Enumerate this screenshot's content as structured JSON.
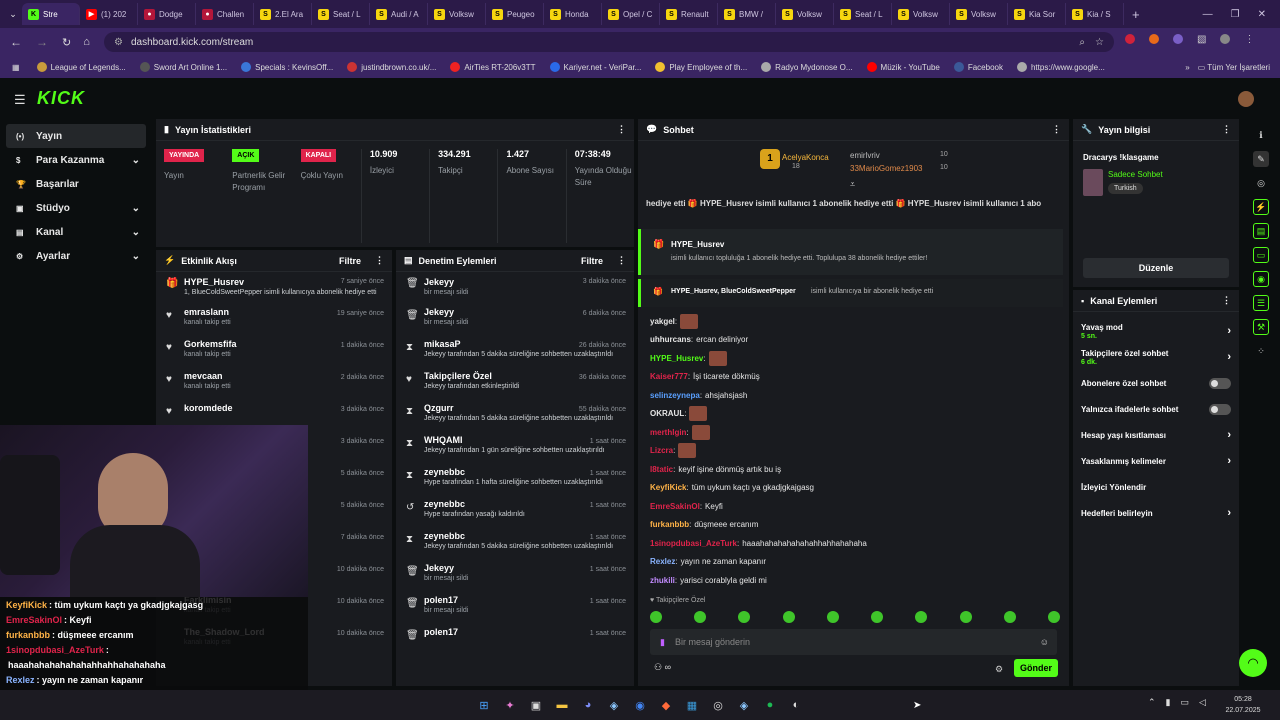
{
  "browser": {
    "tabs": [
      {
        "label": "Stre",
        "icon": "K",
        "color": "#53fc18",
        "active": true
      },
      {
        "label": "(1) 202",
        "icon": "▶",
        "color": "#ff0000"
      },
      {
        "label": "Dodge",
        "icon": "●",
        "color": "#b3163a"
      },
      {
        "label": "Challen",
        "icon": "●",
        "color": "#b3163a"
      },
      {
        "label": "2.El Ara",
        "icon": "S",
        "color": "#f6d60f"
      },
      {
        "label": "Seat / L",
        "icon": "S",
        "color": "#f6d60f"
      },
      {
        "label": "Audi / A",
        "icon": "S",
        "color": "#f6d60f"
      },
      {
        "label": "Volksw",
        "icon": "S",
        "color": "#f6d60f"
      },
      {
        "label": "Peugeo",
        "icon": "S",
        "color": "#f6d60f"
      },
      {
        "label": "Honda",
        "icon": "S",
        "color": "#f6d60f"
      },
      {
        "label": "Opel / C",
        "icon": "S",
        "color": "#f6d60f"
      },
      {
        "label": "Renault",
        "icon": "S",
        "color": "#f6d60f"
      },
      {
        "label": "BMW /",
        "icon": "S",
        "color": "#f6d60f"
      },
      {
        "label": "Volksw",
        "icon": "S",
        "color": "#f6d60f"
      },
      {
        "label": "Seat / L",
        "icon": "S",
        "color": "#f6d60f"
      },
      {
        "label": "Volksw",
        "icon": "S",
        "color": "#f6d60f"
      },
      {
        "label": "Volksw",
        "icon": "S",
        "color": "#f6d60f"
      },
      {
        "label": "Kia Sor",
        "icon": "S",
        "color": "#f6d60f"
      },
      {
        "label": "Kia / S",
        "icon": "S",
        "color": "#f6d60f"
      }
    ],
    "url": "dashboard.kick.com/stream",
    "bookmarks": [
      "League of Legends...",
      "Sword Art Online 1...",
      "Specials : KevinsOff...",
      "justindbrown.co.uk/...",
      "AirTies RT-206v3TT",
      "Kariyer.net - VeriPar...",
      "Play Employee of th...",
      "Radyo Mydonose O...",
      "Müzik - YouTube",
      "Facebook",
      "https://www.google..."
    ],
    "bookmarks_all": "Tüm Yer İşaretleri"
  },
  "sidebar": [
    {
      "label": "Yayın",
      "icon": "(•)",
      "active": true
    },
    {
      "label": "Para Kazanma",
      "icon": "$",
      "chevron": true
    },
    {
      "label": "Başarılar",
      "icon": "🏆"
    },
    {
      "label": "Stüdyo",
      "icon": "▣",
      "chevron": true
    },
    {
      "label": "Kanal",
      "icon": "▤",
      "chevron": true
    },
    {
      "label": "Ayarlar",
      "icon": "⚙",
      "chevron": true
    }
  ],
  "stats": {
    "title": "Yayın İstatistikleri",
    "badges": [
      {
        "badge": "YAYINDA",
        "color": "#e0244b",
        "label": "Yayın"
      },
      {
        "badge": "AÇIK",
        "color": "#53fc18",
        "label": "Partnerlik Gelir Programı"
      },
      {
        "badge": "KAPALI",
        "color": "#e0244b",
        "label": "Çoklu Yayın"
      }
    ],
    "nums": [
      {
        "value": "10.909",
        "label": "İzleyici"
      },
      {
        "value": "334.291",
        "label": "Takipçi"
      },
      {
        "value": "1.427",
        "label": "Abone Sayısı"
      },
      {
        "value": "07:38:49",
        "label": "Yayında Olduğu Süre"
      }
    ]
  },
  "activity": {
    "title": "Etkinlik Akışı",
    "filter": "Filtre",
    "items": [
      {
        "name": "HYPE_Husrev",
        "sub": "1, BlueColdSweetPepper isimli kullanıcıya abonelik hediye etti",
        "time": "7 saniye önce",
        "icon": "🎁"
      },
      {
        "name": "emraslann",
        "sub": "kanalı takip etti",
        "time": "19 saniye önce",
        "icon": "♥"
      },
      {
        "name": "Gorkemsfifa",
        "sub": "kanalı takip etti",
        "time": "1 dakika önce",
        "icon": "♥"
      },
      {
        "name": "mevcaan",
        "sub": "kanalı takip etti",
        "time": "2 dakika önce",
        "icon": "♥"
      },
      {
        "name": "koromdede",
        "sub": "",
        "time": "3 dakika önce",
        "icon": "♥"
      },
      {
        "name": "",
        "sub": "",
        "time": "3 dakika önce",
        "icon": ""
      },
      {
        "name": "",
        "sub": "",
        "time": "5 dakika önce",
        "icon": ""
      },
      {
        "name": "",
        "sub": "",
        "time": "5 dakika önce",
        "icon": ""
      },
      {
        "name": "",
        "sub": "",
        "time": "7 dakika önce",
        "icon": ""
      },
      {
        "name": "",
        "sub": "",
        "time": "10 dakika önce",
        "icon": ""
      },
      {
        "name": "Farklimisin",
        "sub": "kanalı takip etti",
        "time": "10 dakika önce",
        "icon": ""
      },
      {
        "name": "The_Shadow_Lord",
        "sub": "kanalı takip etti",
        "time": "10 dakika önce",
        "icon": ""
      }
    ]
  },
  "moderation": {
    "title": "Denetim Eylemleri",
    "filter": "Filtre",
    "items": [
      {
        "name": "Jekeyy",
        "sub": "bir mesajı sildi",
        "time": "3 dakika önce",
        "icon": "🗑"
      },
      {
        "name": "Jekeyy",
        "sub": "bir mesajı sildi",
        "time": "6 dakika önce",
        "icon": "🗑"
      },
      {
        "name": "mikasaP",
        "sub": "Jekeyy tarafından 5 dakika süreliğine sohbetten uzaklaştırıldı",
        "time": "26 dakika önce",
        "icon": "⧗"
      },
      {
        "name": "Takipçilere Özel",
        "sub": "Jekeyy tarafından etkinleştirildi",
        "time": "36 dakika önce",
        "icon": "♥"
      },
      {
        "name": "Qzgurr",
        "sub": "Jekeyy tarafından 5 dakika süreliğine sohbetten uzaklaştırıldı",
        "time": "55 dakika önce",
        "icon": "⧗"
      },
      {
        "name": "WHQAMI",
        "sub": "Jekeyy tarafından 1 gün süreliğine sohbetten uzaklaştırıldı",
        "time": "1 saat önce",
        "icon": "⧗"
      },
      {
        "name": "zeynebbc",
        "sub": "Hype tarafından 1 hafta süreliğine sohbetten uzaklaştırıldı",
        "time": "1 saat önce",
        "icon": "⧗"
      },
      {
        "name": "zeynebbc",
        "sub": "Hype tarafından yasağı kaldırıldı",
        "time": "1 saat önce",
        "icon": "↺"
      },
      {
        "name": "zeynebbc",
        "sub": "Jekeyy tarafından 5 dakika süreliğine sohbetten uzaklaştırıldı",
        "time": "1 saat önce",
        "icon": "⧗"
      },
      {
        "name": "Jekeyy",
        "sub": "bir mesajı sildi",
        "time": "1 saat önce",
        "icon": "🗑"
      },
      {
        "name": "polen17",
        "sub": "bir mesajı sildi",
        "time": "1 saat önce",
        "icon": "🗑"
      },
      {
        "name": "polen17",
        "sub": "",
        "time": "1 saat önce",
        "icon": "🗑"
      }
    ]
  },
  "chat": {
    "title": "Sohbet",
    "leaders": [
      {
        "name": "AcelyaKonca",
        "count": "18"
      },
      {
        "name": "emirlvriv",
        "count": "10"
      },
      {
        "name": "33MarioGomez1903",
        "count": "10"
      }
    ],
    "ticker": "hediye etti  🎁 HYPE_Husrev isimli kullanıcı 1 abonelik hediye etti  🎁 HYPE_Husrev isimli kullanıcı 1 abo",
    "gift1_name": "HYPE_Husrev",
    "gift1_text": "isimli kullanıcı topluluğa 1 abonelik hediye etti. Toplulupa 38 abonelik hediye ettiler!",
    "gift2_name": "HYPE_Husrev, BlueColdSweetPepper",
    "gift2_text": "isimli kullanıcıya bir abonelik hediye etti",
    "messages": [
      {
        "user": "yakgel",
        "color": "#e6e6e6",
        "text": ""
      },
      {
        "user": "uhhurcans",
        "color": "#e6e6e6",
        "text": "ercan deliniyor"
      },
      {
        "user": "HYPE_Husrev",
        "color": "#53fc18",
        "text": ""
      },
      {
        "user": "Kaiser777",
        "color": "#e0244b",
        "text": "İşi ticarete dökmüş"
      },
      {
        "user": "selinzeynepa",
        "color": "#5aa0ff",
        "text": "ahsjahsjash"
      },
      {
        "user": "OKRAUL",
        "color": "#e6e6e6",
        "text": ""
      },
      {
        "user": "merthlgin",
        "color": "#e0244b",
        "text": ""
      },
      {
        "user": "Lizcra",
        "color": "#e0244b",
        "text": ""
      },
      {
        "user": "l8tatic",
        "color": "#e0244b",
        "text": "keyif işine dönmüş artık bu iş"
      },
      {
        "user": "KeyfiKick",
        "color": "#ffb347",
        "text": "tüm uykum kaçtı ya gkadjgkajgasg"
      },
      {
        "user": "EmreSakinOl",
        "color": "#e0244b",
        "text": "Keyfi"
      },
      {
        "user": "furkanbbb",
        "color": "#ffb347",
        "text": "düşmeee ercanım"
      },
      {
        "user": "1sinopdubasi_AzeTurk",
        "color": "#e0244b",
        "text": "haaahahahahahahahhahhahahaha"
      },
      {
        "user": "Rexlez",
        "color": "#8ab4ff",
        "text": "yayın ne zaman kapanır"
      },
      {
        "user": "zhukili",
        "color": "#c28bff",
        "text": "yarisci corablyla geldi mi"
      }
    ],
    "followers_only": "Takipçilere Özel",
    "placeholder": "Bir mesaj gönderin",
    "send": "Gönder"
  },
  "overlay_chat": [
    {
      "user": "KeyfiKick",
      "color": "#ffb347",
      "text": ": tüm uykum kaçtı ya gkadjgkajgasg"
    },
    {
      "user": "EmreSakinOl",
      "color": "#e0244b",
      "text": ": Keyfi"
    },
    {
      "user": "furkanbbb",
      "color": "#ffb347",
      "text": ": düşmeee ercanım"
    },
    {
      "user": "1sinopdubasi_AzeTurk",
      "color": "#e0244b",
      "text": ":"
    },
    {
      "user": "",
      "color": "#ffffff",
      "text": "haaahahahahahahahhahhahahahaha"
    },
    {
      "user": "Rexlez",
      "color": "#8ab4ff",
      "text": ": yayın ne zaman kapanır"
    }
  ],
  "info": {
    "title": "Yayın bilgisi",
    "stream_title": "Dracarys !klasgame",
    "category": "Sadece Sohbet",
    "tag": "Turkish",
    "edit": "Düzenle"
  },
  "channel_actions": {
    "title": "Kanal Eylemleri",
    "items": [
      {
        "label": "Yavaş mod",
        "sub": "5 sn.",
        "type": "chevron"
      },
      {
        "label": "Takipçilere özel sohbet",
        "sub": "6 dk.",
        "type": "chevron"
      },
      {
        "label": "Abonelere özel sohbet",
        "sub": "",
        "type": "toggle"
      },
      {
        "label": "Yalnızca ifadelerle sohbet",
        "sub": "",
        "type": "toggle"
      },
      {
        "label": "Hesap yaşı kısıtlaması",
        "sub": "",
        "type": "chevron"
      },
      {
        "label": "Yasaklanmış kelimeler",
        "sub": "",
        "type": "chevron"
      },
      {
        "label": "İzleyici Yönlendir",
        "sub": "",
        "type": "none"
      },
      {
        "label": "Hedefleri belirleyin",
        "sub": "",
        "type": "chevron"
      }
    ]
  },
  "clock": {
    "time": "05:28",
    "date": "22.07.2025"
  },
  "colors": {
    "accent": "#53fc18",
    "panel": "#191b1f",
    "bg": "#0b0e0f",
    "red": "#e0244b"
  }
}
